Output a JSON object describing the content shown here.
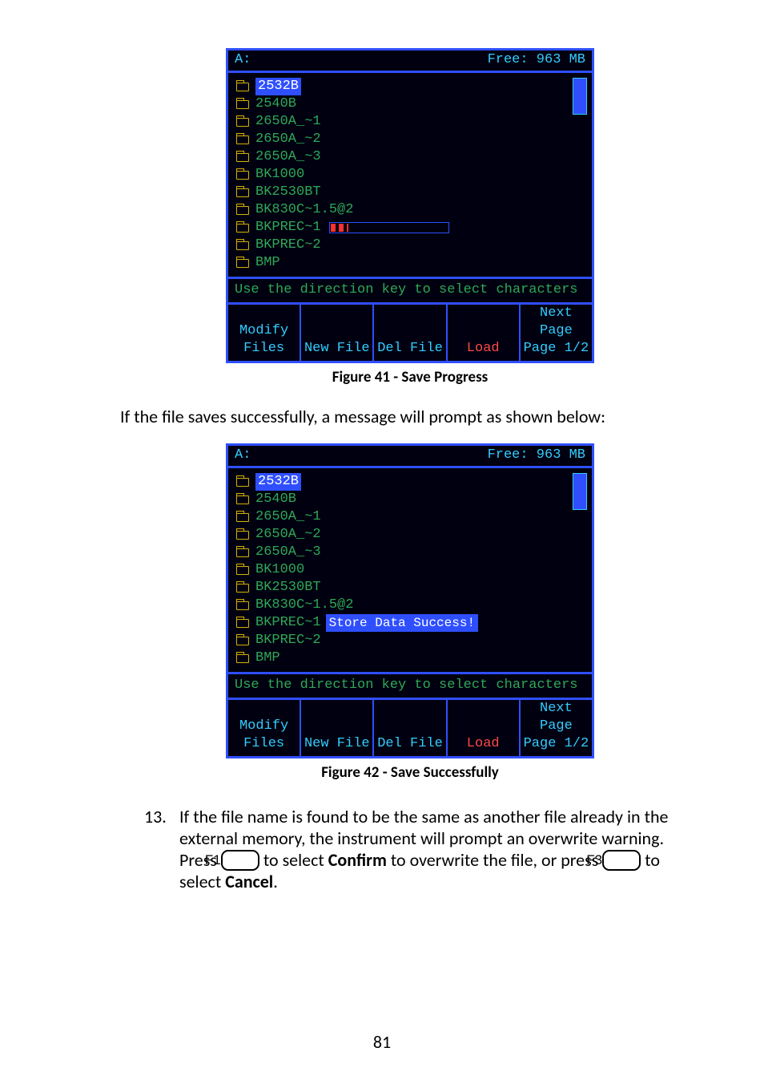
{
  "screenshot1": {
    "header_left": "A:",
    "header_right": "Free: 963 MB",
    "filenames": [
      "2532B",
      "2540B",
      "2650A_~1",
      "2650A_~2",
      "2650A_~3",
      "BK1000",
      "BK2530BT",
      "BK830C~1.5@2",
      "BKPREC~1",
      "BKPREC~2",
      "BMP"
    ],
    "hint": "Use the direction key to select characters",
    "softkeys": {
      "c1_top": "Modify",
      "c1_bot": "Files",
      "c2_bot": "New File",
      "c3_bot": "Del File",
      "c4_bot": "Load",
      "c5_top": "Next Page",
      "c5_bot": "Page 1/2"
    }
  },
  "caption1": "Figure 41 - Save Progress",
  "para1": "If the file saves successfully, a message will prompt as shown below:",
  "screenshot2": {
    "header_left": "A:",
    "header_right": "Free: 963 MB",
    "filenames": [
      "2532B",
      "2540B",
      "2650A_~1",
      "2650A_~2",
      "2650A_~3",
      "BK1000",
      "BK2530BT",
      "BK830C~1.5@2",
      "BKPREC~1",
      "BKPREC~2",
      "BMP"
    ],
    "success_msg": "Store Data Success!",
    "hint": "Use the direction key to select characters",
    "softkeys": {
      "c1_top": "Modify",
      "c1_bot": "Files",
      "c2_bot": "New File",
      "c3_bot": "Del File",
      "c4_bot": "Load",
      "c5_top": "Next Page",
      "c5_bot": "Page 1/2"
    }
  },
  "caption2": "Figure 42 - Save Successfully",
  "step13": {
    "num": "13.",
    "text1": "If the file name is found to be the same as another file already in the external memory, the instrument will prompt an overwrite warning. Press ",
    "key1": "F1",
    "text2": " to select ",
    "bold1": "Confirm",
    "text3": " to overwrite the file, or press ",
    "key2": "F3",
    "text4": " to select ",
    "bold2": "Cancel",
    "text5": "."
  },
  "page_number": "81"
}
